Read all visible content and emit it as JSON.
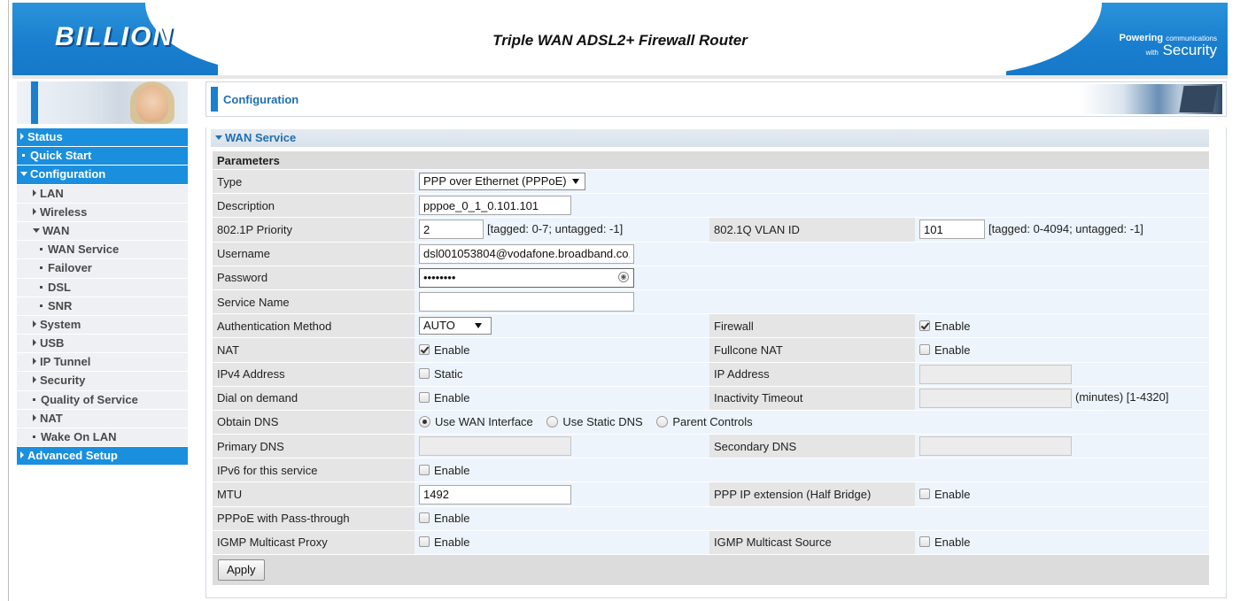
{
  "header": {
    "logo": "BILLION",
    "title": "Triple WAN ADSL2+ Firewall Router",
    "tagline_powering": "Powering",
    "tagline_communications": "communications",
    "tagline_with": "with",
    "tagline_security": "Security"
  },
  "sidebar": {
    "items": [
      {
        "label": "Status"
      },
      {
        "label": "Quick Start"
      },
      {
        "label": "Configuration"
      },
      {
        "label": "LAN"
      },
      {
        "label": "Wireless"
      },
      {
        "label": "WAN"
      },
      {
        "label": "WAN Service"
      },
      {
        "label": "Failover"
      },
      {
        "label": "DSL"
      },
      {
        "label": "SNR"
      },
      {
        "label": "System"
      },
      {
        "label": "USB"
      },
      {
        "label": "IP Tunnel"
      },
      {
        "label": "Security"
      },
      {
        "label": "Quality of Service"
      },
      {
        "label": "NAT"
      },
      {
        "label": "Wake On LAN"
      },
      {
        "label": "Advanced Setup"
      }
    ]
  },
  "page": {
    "title": "Configuration",
    "section": "WAN Service",
    "parameters": "Parameters"
  },
  "form": {
    "type_label": "Type",
    "type_value": "PPP over Ethernet (PPPoE)",
    "description_label": "Description",
    "description_value": "pppoe_0_1_0.101.101",
    "priority_label": "802.1P Priority",
    "priority_value": "2",
    "priority_hint": "[tagged: 0-7; untagged: -1]",
    "vlan_label": "802.1Q VLAN ID",
    "vlan_value": "101",
    "vlan_hint": "[tagged: 0-4094; untagged: -1]",
    "username_label": "Username",
    "username_value": "dsl001053804@vodafone.broadband.co.",
    "password_label": "Password",
    "password_value": "••••••••",
    "service_name_label": "Service Name",
    "service_name_value": "",
    "auth_label": "Authentication Method",
    "auth_value": "AUTO",
    "firewall_label": "Firewall",
    "nat_label": "NAT",
    "fullcone_label": "Fullcone NAT",
    "ipv4_label": "IPv4 Address",
    "static_text": "Static",
    "ip_address_label": "IP Address",
    "dial_label": "Dial on demand",
    "inactivity_label": "Inactivity Timeout",
    "inactivity_hint": "(minutes)  [1-4320]",
    "obtain_dns_label": "Obtain DNS",
    "dns_opt1": "Use WAN Interface",
    "dns_opt2": "Use Static DNS",
    "dns_opt3": "Parent Controls",
    "primary_dns_label": "Primary DNS",
    "secondary_dns_label": "Secondary DNS",
    "ipv6_label": "IPv6 for this service",
    "mtu_label": "MTU",
    "mtu_value": "1492",
    "ppp_ip_ext_label": "PPP IP extension (Half Bridge)",
    "pppoe_pass_label": "PPPoE with Pass-through",
    "igmp_proxy_label": "IGMP Multicast Proxy",
    "igmp_source_label": "IGMP Multicast Source",
    "enable_text": "Enable",
    "apply_label": "Apply"
  },
  "colors": {
    "brand_blue": "#1a7fcf",
    "menu_blue": "#1a8fde",
    "title_blue": "#1f6fb2"
  }
}
